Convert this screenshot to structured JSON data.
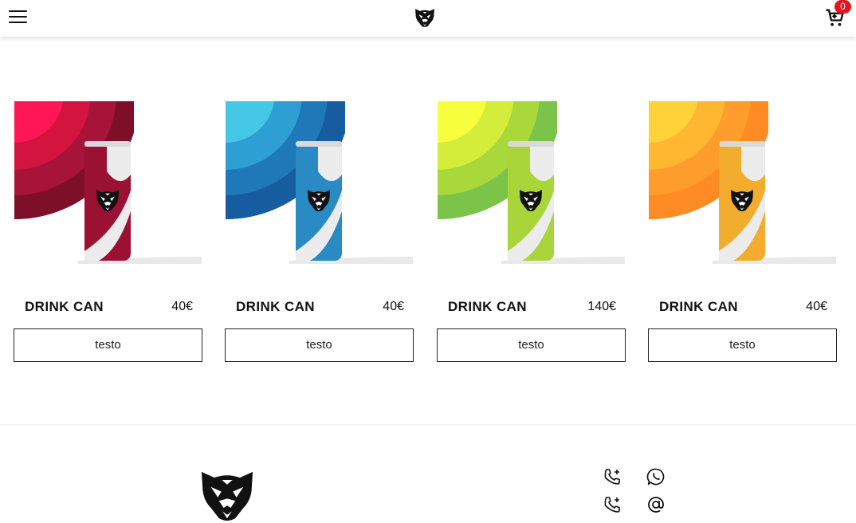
{
  "header": {
    "menu_icon": "hamburger-menu-icon",
    "brand_icon": "tiger-head-logo",
    "cart_icon": "shopping-cart-icon",
    "cart_count": "0"
  },
  "products": [
    {
      "name": "DRINK CAN",
      "price": "40€",
      "button": "testo",
      "color": "crimson"
    },
    {
      "name": "DRINK CAN",
      "price": "40€",
      "button": "testo",
      "color": "blue"
    },
    {
      "name": "DRINK CAN",
      "price": "140€",
      "button": "testo",
      "color": "lime"
    },
    {
      "name": "DRINK CAN",
      "price": "40€",
      "button": "testo",
      "color": "orange"
    }
  ],
  "footer": {
    "logo": "tiger-head-logo",
    "contact_icons": [
      "phone-add-icon",
      "whatsapp-icon",
      "phone-add-icon",
      "at-sign-icon"
    ]
  },
  "colors": {
    "badge": "#e6141e",
    "crimson": [
      "#ff1654",
      "#d2143f",
      "#a8133a",
      "#7d1028"
    ],
    "blue": [
      "#45c8e6",
      "#2e9fd2",
      "#1f78b8",
      "#165da0"
    ],
    "lime": [
      "#f7ff3c",
      "#d4ec3a",
      "#a8d83a",
      "#7cc34a"
    ],
    "orange": [
      "#ffd23a",
      "#ffb732",
      "#ff9d2c",
      "#ff8b24"
    ]
  }
}
